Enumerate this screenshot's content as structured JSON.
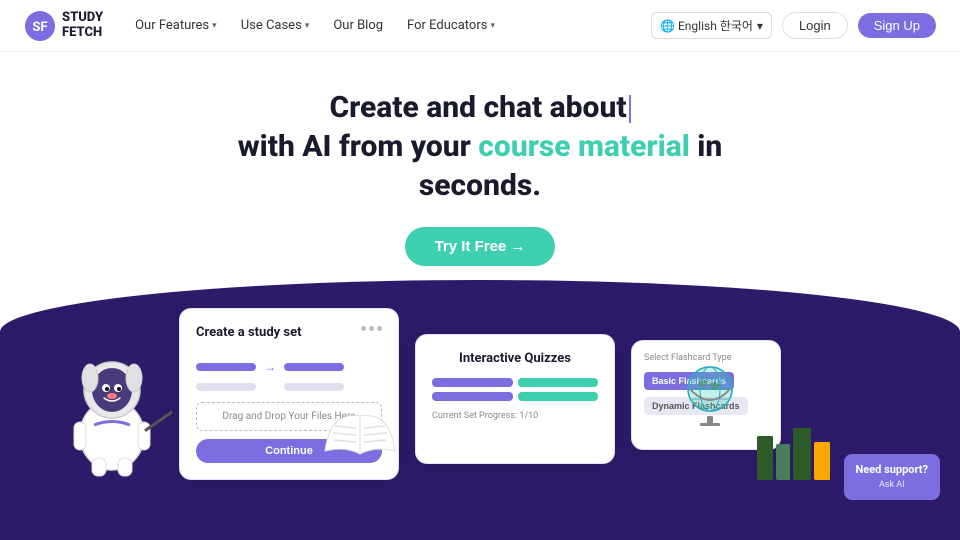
{
  "brand": {
    "name_line1": "STUDY",
    "name_line2": "FETCH"
  },
  "nav": {
    "links": [
      {
        "label": "Our Features",
        "has_dropdown": true
      },
      {
        "label": "Use Cases",
        "has_dropdown": true
      },
      {
        "label": "Our Blog",
        "has_dropdown": false
      },
      {
        "label": "For Educators",
        "has_dropdown": true
      }
    ],
    "language_label": "🌐 English 한국어",
    "login_label": "Login",
    "signup_label": "Sign Up"
  },
  "hero": {
    "line1": "Create and chat about",
    "line2_normal1": "with AI from your",
    "line2_highlight": "course material",
    "line2_normal2": "in",
    "line3": "seconds.",
    "cta_label": "Try It Free →"
  },
  "card_study": {
    "title": "Create a study set",
    "drag_label": "Drag and Drop Your Files Here",
    "continue_label": "Continue"
  },
  "card_quiz": {
    "title": "Interactive Quizzes",
    "progress_label": "Current Set Progress: 1/10"
  },
  "card_flashcard": {
    "title": "Select Flashcard Type",
    "btn1": "Basic Flashcards",
    "btn2": "Dynamic Flashcards"
  },
  "support": {
    "title": "Need support?",
    "subtitle": "Ask AI"
  }
}
